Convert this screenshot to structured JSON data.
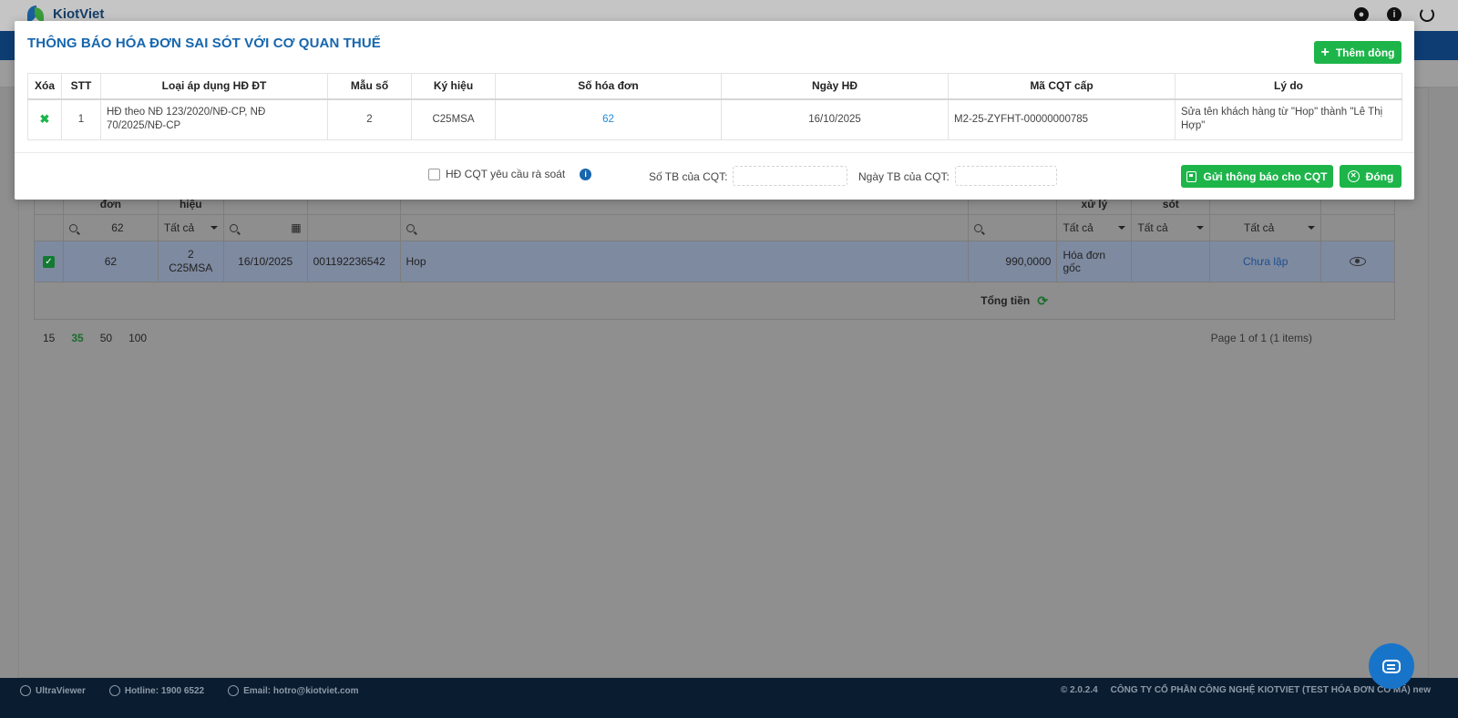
{
  "app": {
    "brand": "KiotViet"
  },
  "topbar_icons": [
    "user-icon",
    "info-icon",
    "power-icon"
  ],
  "modal": {
    "title": "THÔNG BÁO HÓA ĐƠN SAI SÓT VỚI CƠ QUAN THUẾ",
    "add_row_label": "Thêm dòng",
    "columns": [
      "Xóa",
      "STT",
      "Loại áp dụng HĐ ĐT",
      "Mẫu số",
      "Ký hiệu",
      "Số hóa đơn",
      "Ngày HĐ",
      "Mã CQT cấp",
      "Lý do"
    ],
    "rows": [
      {
        "delete": "✖",
        "stt": "1",
        "type": "HĐ theo NĐ 123/2020/NĐ-CP, NĐ 70/2025/NĐ-CP",
        "form": "2",
        "symbol": "C25MSA",
        "invoice_no": "62",
        "date": "16/10/2025",
        "tax_code": "M2-25-ZYFHT-00000000785",
        "reason": "Sửa tên khách hàng từ \"Hop\" thành \"Lê Thị Hợp\""
      }
    ],
    "review_checkbox_label": "HĐ CQT yêu cầu rà soát",
    "notice_no_label": "Số TB của CQT:",
    "notice_no_value": "",
    "notice_date_label": "Ngày TB của CQT:",
    "notice_date_value": "",
    "send_label": "Gửi thông báo cho CQT",
    "close_label": "Đóng"
  },
  "background": {
    "headers": [
      "đơn",
      "hiệu",
      "",
      "",
      "",
      "",
      "xử lý",
      "sót",
      "",
      ""
    ],
    "filters": {
      "invoice_no": "62",
      "all": "Tất cả"
    },
    "row": {
      "invoice_no": "62",
      "form": "2",
      "symbol": "C25MSA",
      "date": "16/10/2025",
      "tax_id": "001192236542",
      "customer": "Hop",
      "amount": "990,0000",
      "status": "Hóa đơn gốc",
      "error_status": "Chưa lập"
    },
    "total_label": "Tổng tiền",
    "page_sizes": [
      "15",
      "35",
      "50",
      "100"
    ],
    "active_page_size": "35",
    "page_info": "Page 1 of 1 (1 items)"
  },
  "footer": {
    "ultraviewer": "UltraViewer",
    "hotline": "Hotline: 1900 6522",
    "email": "Email: hotro@kiotviet.com",
    "version": "© 2.0.2.4",
    "company": "CÔNG TY CỔ PHẦN CÔNG NGHỆ KIOTVIET (TEST HÓA ĐƠN CÓ MÃ) new"
  }
}
